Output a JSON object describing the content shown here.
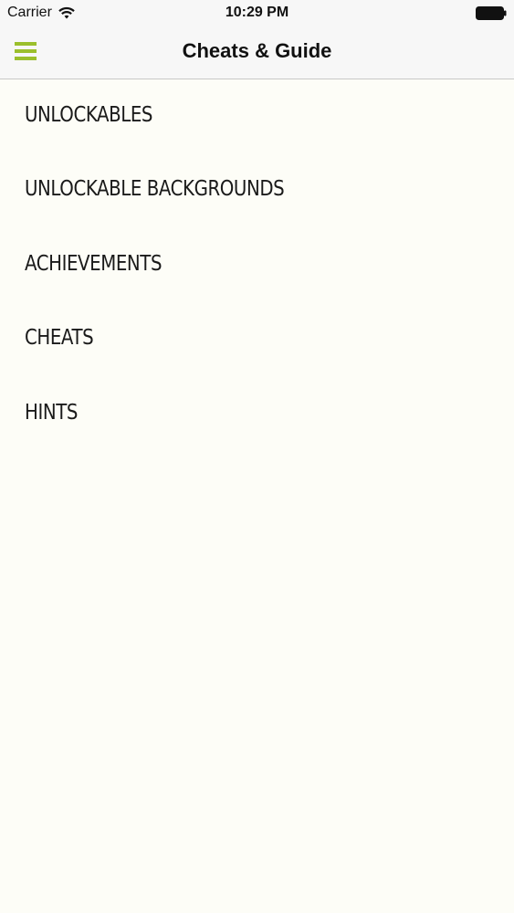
{
  "status_bar": {
    "carrier": "Carrier",
    "time": "10:29 PM",
    "wifi_icon": "wifi-icon",
    "battery_icon": "battery-icon"
  },
  "nav_bar": {
    "title": "Cheats & Guide",
    "menu_icon": "hamburger-menu-icon",
    "accent_color": "#9bbf2c"
  },
  "menu": {
    "items": [
      {
        "label": "UNLOCKABLES"
      },
      {
        "label": "UNLOCKABLE BACKGROUNDS"
      },
      {
        "label": "ACHIEVEMENTS"
      },
      {
        "label": "CHEATS"
      },
      {
        "label": "HINTS"
      }
    ]
  },
  "colors": {
    "background": "#fdfdf7",
    "bar_background": "#f7f7f7",
    "text": "#1a1a1a"
  }
}
